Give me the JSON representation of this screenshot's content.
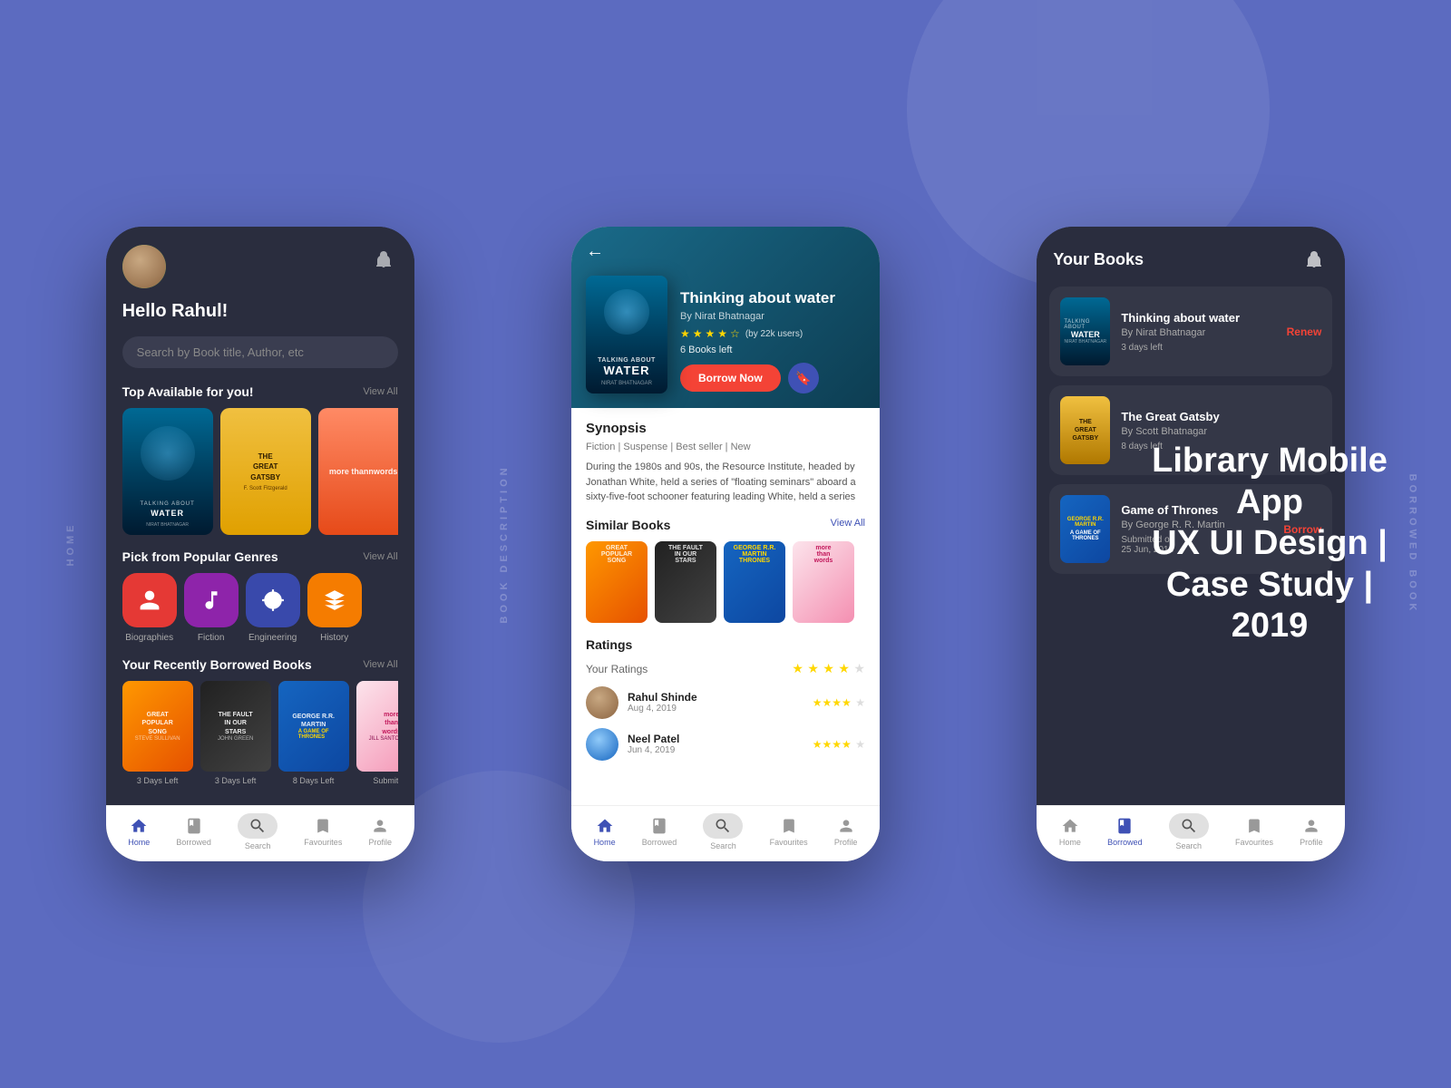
{
  "app": {
    "title": "Library Mobile App",
    "subtitle": "UX UI Design |",
    "subtitle2": "Case Study | 2019"
  },
  "phone1": {
    "greeting": "Hello Rahul!",
    "search_placeholder": "Search by Book title, Author, etc",
    "section1_title": "Top Available for you!",
    "view_all": "View All",
    "section2_title": "Pick from Popular Genres",
    "section3_title": "Your Recently Borrowed Books",
    "genres": [
      {
        "name": "Biographies",
        "icon": "★"
      },
      {
        "name": "Fiction",
        "icon": "🎵"
      },
      {
        "name": "Engineering",
        "icon": "⚙"
      },
      {
        "name": "History",
        "icon": "🏛"
      }
    ],
    "recent_books": [
      {
        "label": "3 Days Left"
      },
      {
        "label": "3 Days Left"
      },
      {
        "label": "8 Days Left"
      },
      {
        "label": "Submitted"
      }
    ],
    "nav": [
      {
        "label": "Home",
        "active": true
      },
      {
        "label": "Borrowed",
        "active": false
      },
      {
        "label": "Search",
        "active": false
      },
      {
        "label": "Favourites",
        "active": false
      },
      {
        "label": "Profile",
        "active": false
      }
    ]
  },
  "phone2": {
    "book_title": "Thinking about water",
    "book_author": "By Nirat Bhatnagar",
    "rating": "4.2",
    "rating_count": "(by 22k users)",
    "books_left": "6 Books left",
    "borrow_btn": "Borrow Now",
    "synopsis_title": "Synopsis",
    "genre_tags": "Fiction  |  Suspense  |  Best seller  |  New",
    "synopsis_text": "During the 1980s and 90s, the Resource Institute, headed by Jonathan White, held a series of \"floating seminars\" aboard a sixty-five-foot schooner featuring leading White, held a series",
    "similar_title": "Similar Books",
    "similar_view_all": "View All",
    "ratings_title": "Ratings",
    "your_ratings_label": "Your Ratings",
    "reviews": [
      {
        "name": "Rahul Shinde",
        "date": "Aug 4, 2019",
        "stars": 4
      },
      {
        "name": "Neel Patel",
        "date": "Jun 4, 2019",
        "stars": 4
      }
    ],
    "nav": [
      {
        "label": "Home",
        "active": true
      },
      {
        "label": "Borrowed",
        "active": false
      },
      {
        "label": "Search",
        "active": false
      },
      {
        "label": "Favourites",
        "active": false
      },
      {
        "label": "Profile",
        "active": false
      }
    ]
  },
  "phone3": {
    "header_title": "Your Books",
    "borrowed_books": [
      {
        "title": "Thinking about water",
        "author": "By Nirat Bhatnagar",
        "days_left": "3 days left",
        "action": "Renew",
        "action_type": "renew"
      },
      {
        "title": "The Great Gatsby",
        "author": "By Scott Bhatnagar",
        "days_left": "8 days left",
        "action": "",
        "action_type": "none"
      },
      {
        "title": "Game of Thrones",
        "author": "By George R. R. Martin",
        "days_left": "Submitted on\n25 Jun, 2018",
        "action": "Borrow",
        "action_type": "borrow"
      }
    ],
    "nav": [
      {
        "label": "Home",
        "active": false
      },
      {
        "label": "Borrowed",
        "active": true
      },
      {
        "label": "Search",
        "active": false
      },
      {
        "label": "Favourites",
        "active": false
      },
      {
        "label": "Profile",
        "active": false
      }
    ]
  },
  "labels": {
    "home": "HOME",
    "book_description": "BOOK DESCRIPTION",
    "borrowed_book": "BORROWED BOOK"
  }
}
